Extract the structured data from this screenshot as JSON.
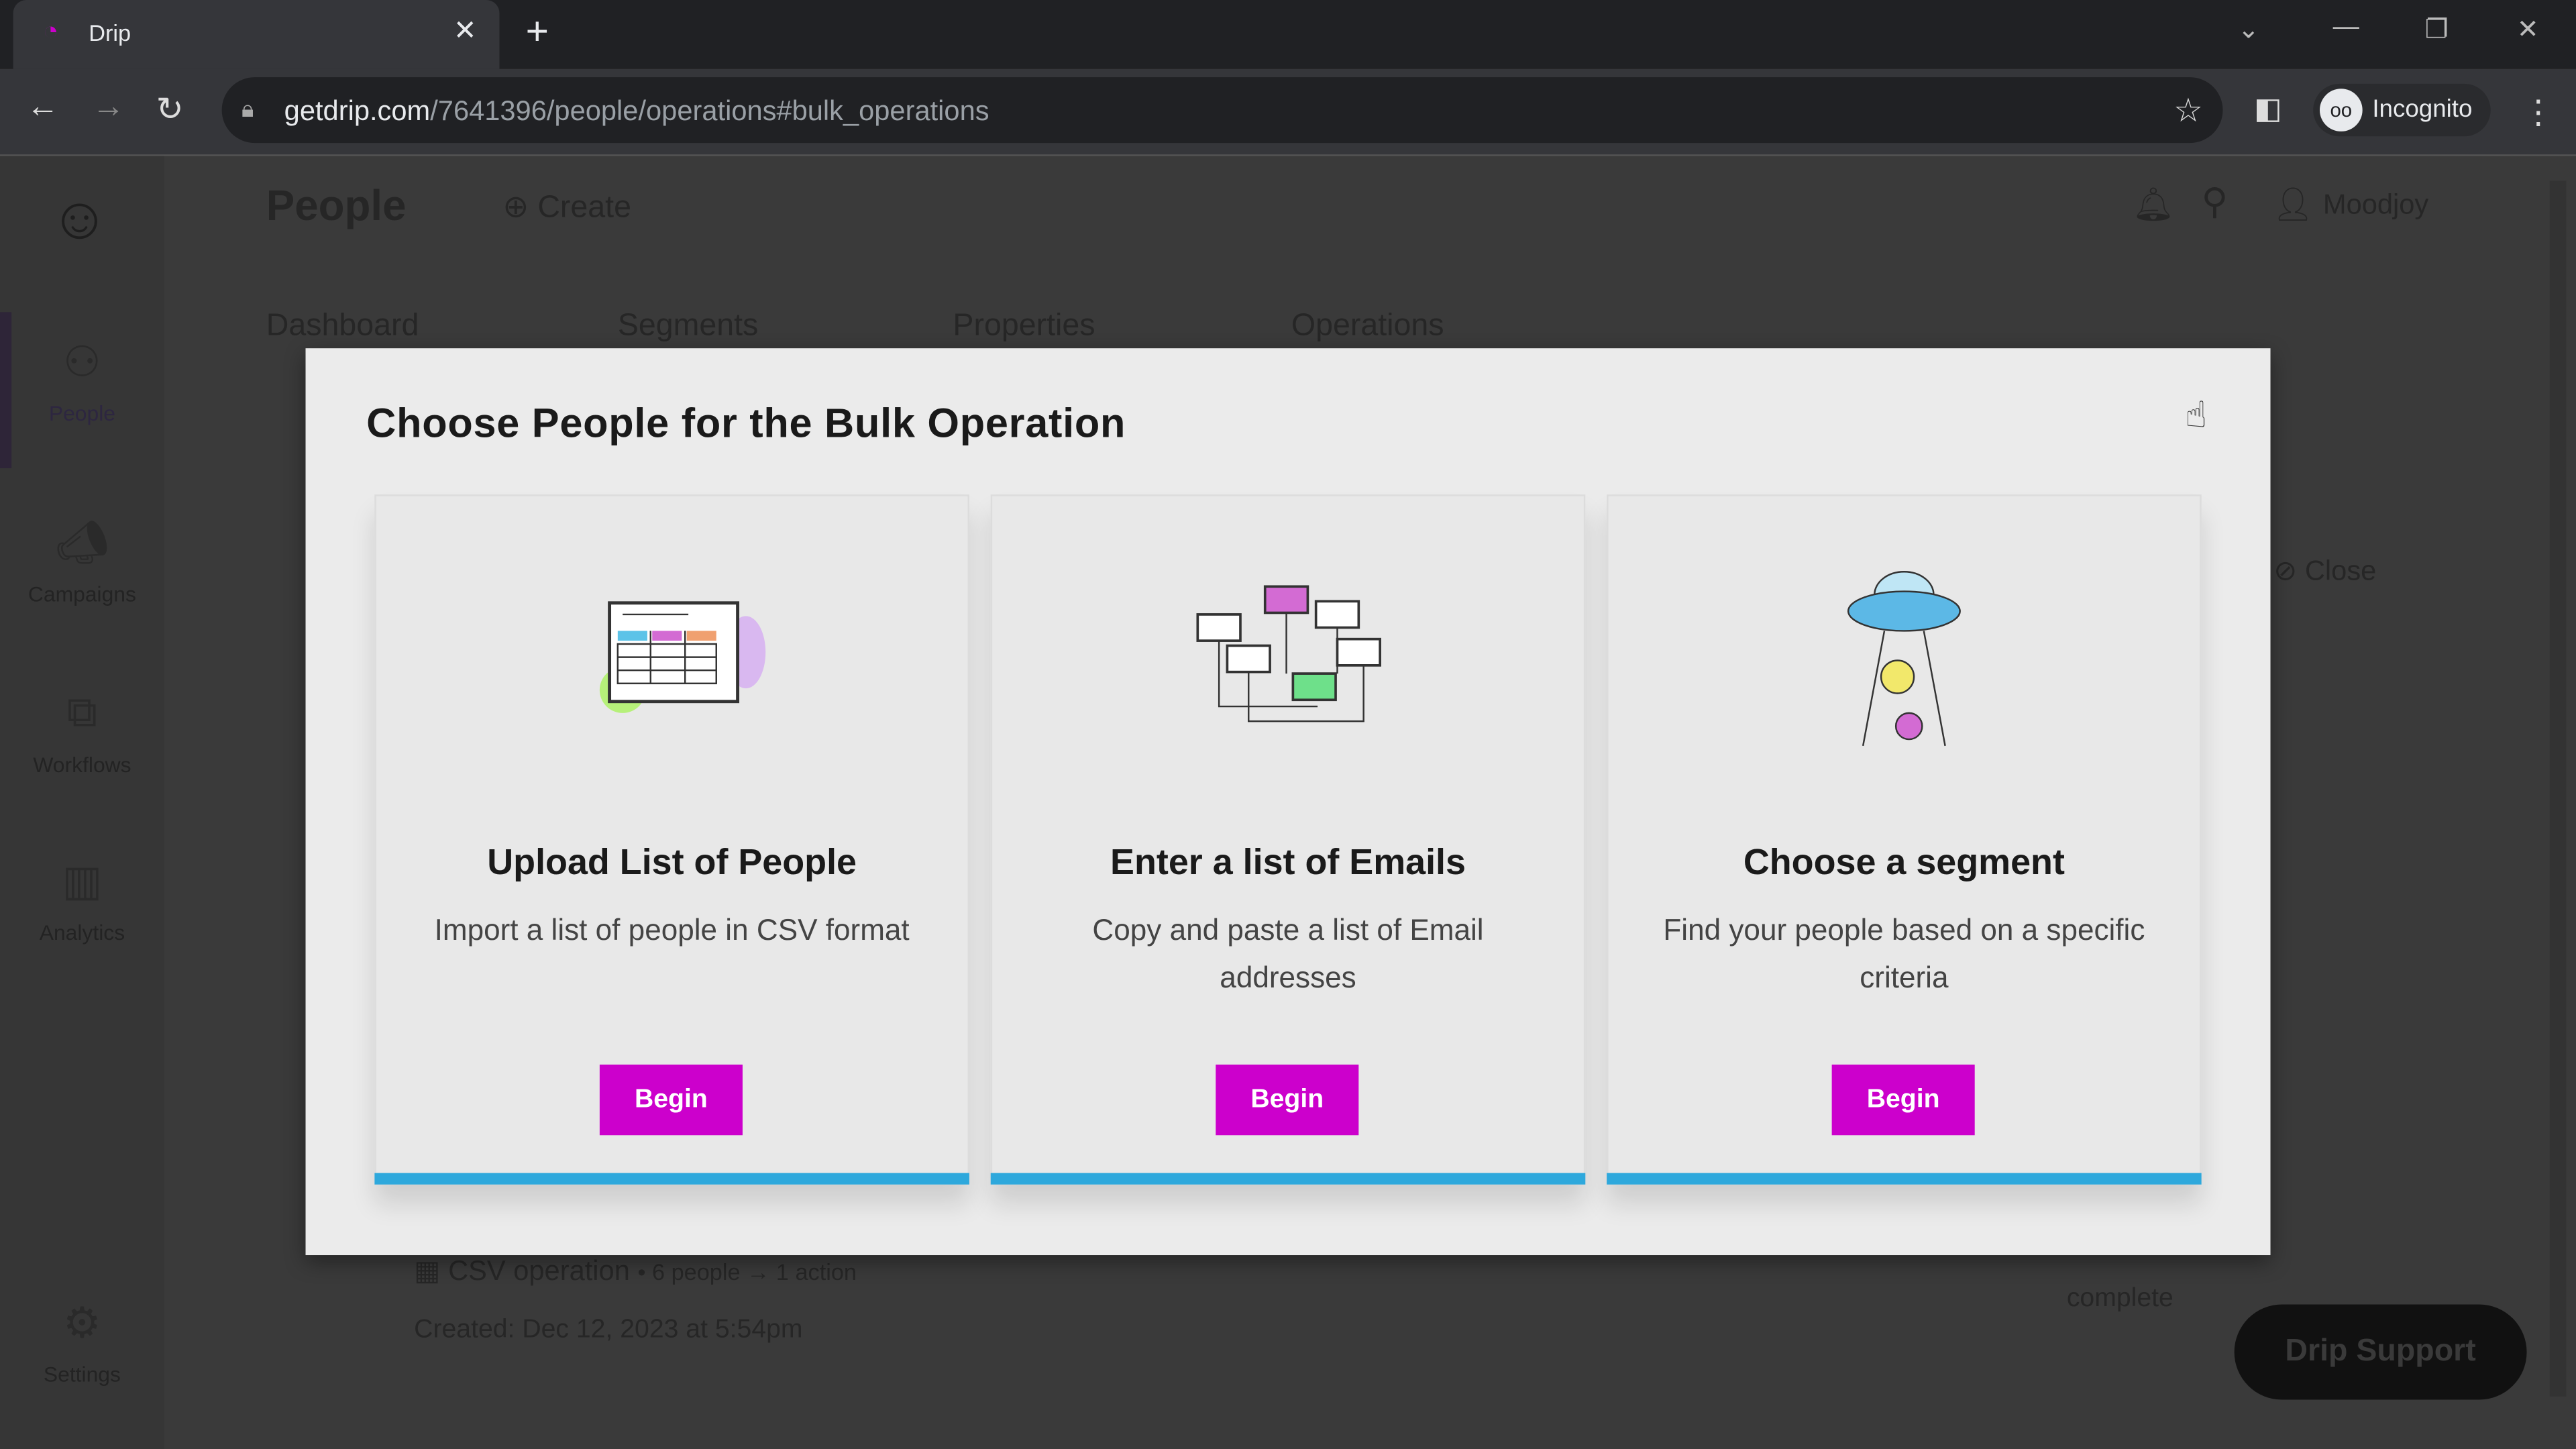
{
  "browser": {
    "tab_title": "Drip",
    "url_host": "getdrip.com",
    "url_path": "/7641396/people/operations#bulk_operations",
    "profile": "Incognito"
  },
  "header": {
    "title": "People",
    "create": "Create",
    "user": "Moodjoy"
  },
  "tabs": [
    "Dashboard",
    "Segments",
    "Properties",
    "Operations"
  ],
  "sidebar": {
    "items": [
      {
        "label": "People",
        "icon": "people-icon"
      },
      {
        "label": "Campaigns",
        "icon": "megaphone-icon"
      },
      {
        "label": "Workflows",
        "icon": "workflow-icon"
      },
      {
        "label": "Analytics",
        "icon": "chart-icon"
      },
      {
        "label": "Settings",
        "icon": "gear-icon"
      }
    ]
  },
  "background": {
    "close": "Close",
    "op_title": "CSV operation",
    "op_meta": "• 6 people → 1 action",
    "op_created": "Created: Dec 12, 2023 at 5:54pm",
    "op_status": "complete",
    "support": "Drip Support"
  },
  "modal": {
    "title": "Choose People for the Bulk Operation",
    "cards": [
      {
        "title": "Upload List of People",
        "desc": "Import a list of people in CSV format",
        "button": "Begin"
      },
      {
        "title": "Enter a list of Emails",
        "desc": "Copy and paste a list of Email addresses",
        "button": "Begin"
      },
      {
        "title": "Choose a segment",
        "desc": "Find your people based on a specific criteria",
        "button": "Begin"
      }
    ]
  },
  "colors": {
    "accent": "#cc00cc",
    "card_bar": "#2ea8dc"
  }
}
